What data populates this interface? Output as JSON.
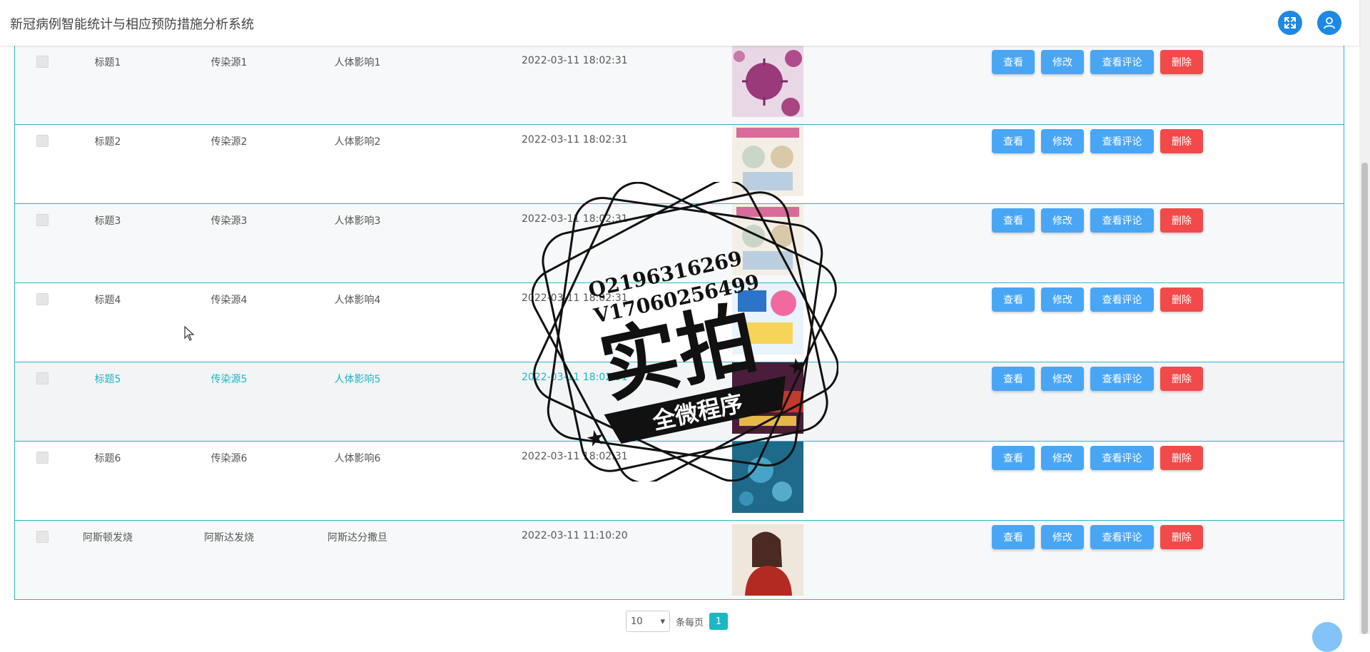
{
  "header": {
    "app_title": "新冠病例智能统计与相应预防措施分析系统",
    "icons": [
      "fullscreen-icon",
      "user-icon"
    ],
    "accent": "#1e88e5"
  },
  "actions": {
    "view": "查看",
    "edit": "修改",
    "comments": "查看评论",
    "delete": "删除"
  },
  "rows": [
    {
      "title": "标题1",
      "source": "传染源1",
      "effect": "人体影响1",
      "time": "2022-03-11 18:02:31",
      "image": "virus"
    },
    {
      "title": "标题2",
      "source": "传染源2",
      "effect": "人体影响2",
      "time": "2022-03-11 18:02:31",
      "image": "poster"
    },
    {
      "title": "标题3",
      "source": "传染源3",
      "effect": "人体影响3",
      "time": "2022-03-11 18:02:31",
      "image": "poster"
    },
    {
      "title": "标题4",
      "source": "传染源4",
      "effect": "人体影响4",
      "time": "2022-03-11 18:02:31",
      "image": "tips"
    },
    {
      "title": "标题5",
      "source": "传染源5",
      "effect": "人体影响5",
      "time": "2022-03-11 18:02:31",
      "image": "banner"
    },
    {
      "title": "标题6",
      "source": "传染源6",
      "effect": "人体影响6",
      "time": "2022-03-11 18:02:31",
      "image": "microscope"
    },
    {
      "title": "阿斯顿发烧",
      "source": "阿斯达发烧",
      "effect": "阿斯达分撒旦",
      "time": "2022-03-11 11:10:20",
      "image": "portrait"
    }
  ],
  "pagination": {
    "page_size": "10",
    "per_page_label": "条每页",
    "current_page": "1"
  },
  "watermark": {
    "line1": "Q2196316269",
    "line2": "V17060256499",
    "big_text": "实拍",
    "ribbon_text": "全微程序"
  },
  "colors": {
    "button_primary": "#49a6f5",
    "button_danger": "#f24a4a",
    "row_border": "#2ab7c6",
    "highlight_text": "#1cb6c5"
  }
}
